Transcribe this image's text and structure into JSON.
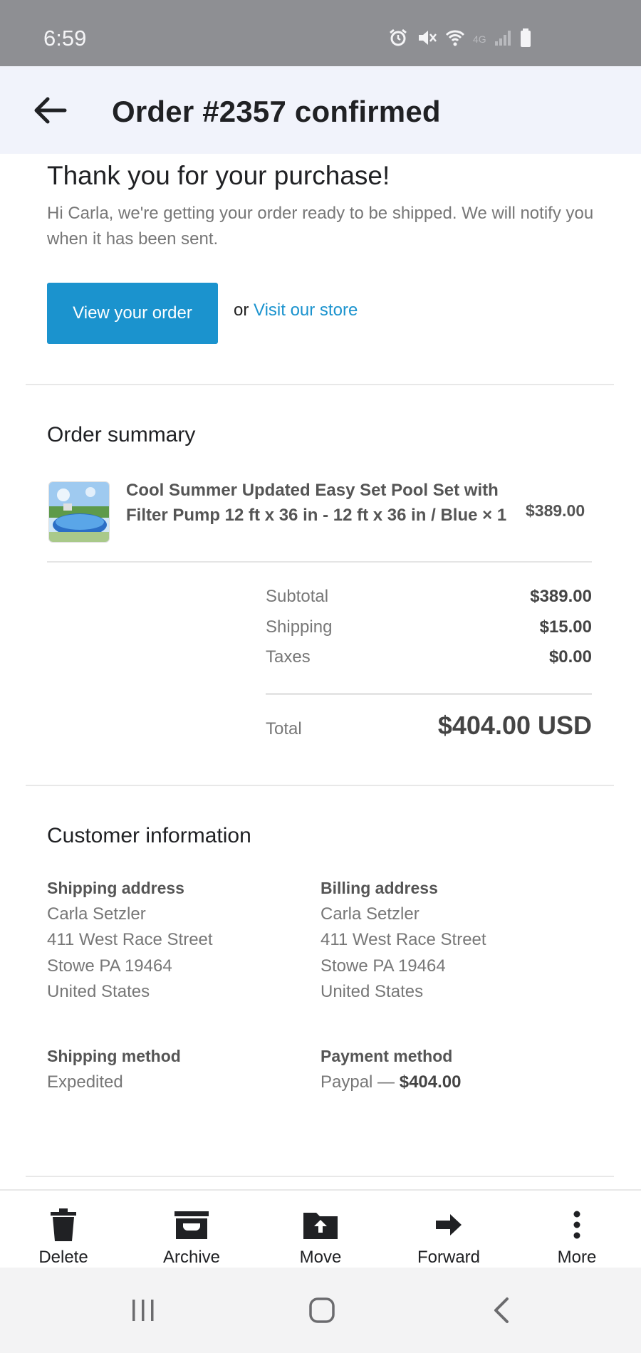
{
  "status_bar": {
    "time": "6:59",
    "network": "4G"
  },
  "header": {
    "title": "Order #2357 confirmed"
  },
  "message": {
    "heading": "Thank you for your purchase!",
    "intro": "Hi Carla, we're getting your order ready to be shipped. We will notify you when it has been sent.",
    "view_order_label": "View your order",
    "or_text": "or",
    "store_link_label": "Visit our store"
  },
  "order_summary": {
    "title": "Order summary",
    "item": {
      "name": "Cool Summer Updated Easy Set Pool Set with Filter Pump 12 ft x 36 in - 12 ft x 36 in / Blue × 1",
      "price": "$389.00"
    },
    "subtotal_label": "Subtotal",
    "subtotal": "$389.00",
    "shipping_label": "Shipping",
    "shipping": "$15.00",
    "taxes_label": "Taxes",
    "taxes": "$0.00",
    "total_label": "Total",
    "total": "$404.00 USD"
  },
  "customer": {
    "title": "Customer information",
    "shipping_address": {
      "title": "Shipping address",
      "lines": [
        "Carla Setzler",
        "411 West Race Street",
        "Stowe PA 19464",
        "United States"
      ]
    },
    "billing_address": {
      "title": "Billing address",
      "lines": [
        "Carla Setzler",
        "411 West Race Street",
        "Stowe PA 19464",
        "United States"
      ]
    },
    "shipping_method": {
      "title": "Shipping method",
      "value": "Expedited"
    },
    "payment_method": {
      "title": "Payment method",
      "value": "Paypal —",
      "amount": "$404.00"
    }
  },
  "actions": {
    "delete": "Delete",
    "archive": "Archive",
    "move": "Move",
    "forward": "Forward",
    "more": "More"
  },
  "colors": {
    "accent": "#1b93ce",
    "status_bar": "#8e8f93",
    "app_bar": "#f1f3fb"
  }
}
